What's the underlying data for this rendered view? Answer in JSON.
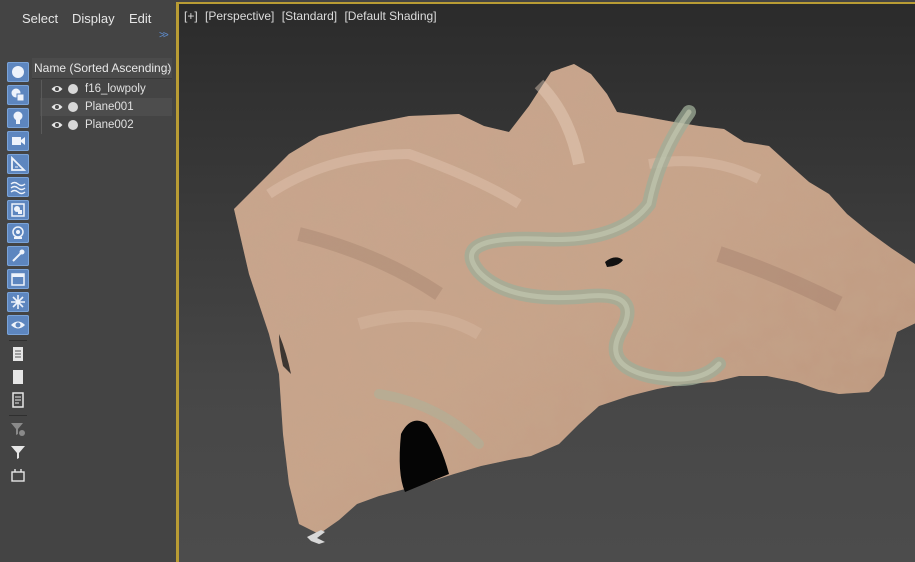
{
  "menu": {
    "select": "Select",
    "display": "Display",
    "edit": "Edit"
  },
  "explorer": {
    "column_header": "Name (Sorted Ascending)",
    "items": [
      {
        "name": "f16_lowpoly",
        "visible": true
      },
      {
        "name": "Plane001",
        "visible": true
      },
      {
        "name": "Plane002",
        "visible": true
      }
    ],
    "toolbar_icons": [
      "display-all-icon",
      "display-geometry-icon",
      "display-lights-icon",
      "display-cameras-icon",
      "display-helpers-icon",
      "display-spacewarps-icon",
      "display-groups-icon",
      "display-xrefs-icon",
      "display-bones-icon",
      "display-containers-icon",
      "display-frozen-icon",
      "display-hidden-icon",
      "select-all-icon",
      "select-none-icon",
      "select-invert-icon",
      "filter-settings-icon",
      "filter-icon",
      "layer-icon"
    ]
  },
  "viewport": {
    "labels": [
      "[+]",
      "[Perspective]",
      "[Standard]",
      "[Default Shading]"
    ],
    "active_border_color": "#b99c34"
  }
}
